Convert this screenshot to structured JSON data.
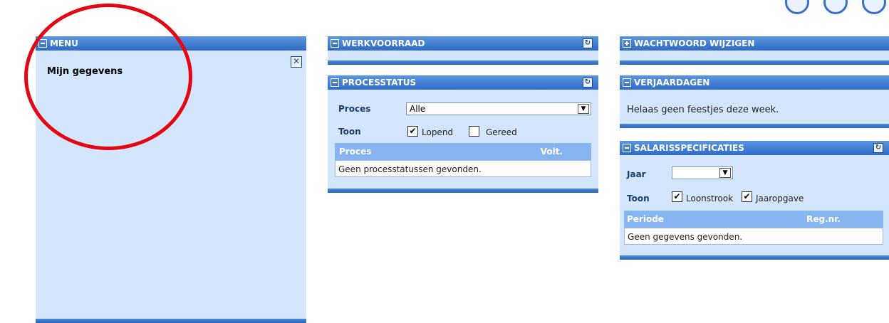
{
  "menu": {
    "title": "MENU",
    "item": "Mijn gegevens",
    "close_icon": "close-icon"
  },
  "werkvoorraad": {
    "title": "WERKVOORRAAD"
  },
  "processtatus": {
    "title": "PROCESSTATUS",
    "proces_label": "Proces",
    "proces_value": "Alle",
    "toon_label": "Toon",
    "cb1_label": "Lopend",
    "cb1_checked": true,
    "cb2_label": "Gereed",
    "cb2_checked": false,
    "col1": "Proces",
    "col2": "Volt.",
    "empty": "Geen processtatussen gevonden."
  },
  "wachtwoord": {
    "title": "WACHTWOORD WIJZIGEN"
  },
  "verjaardagen": {
    "title": "VERJAARDAGEN",
    "text": "Helaas geen feestjes deze week."
  },
  "salaris": {
    "title": "SALARISSPECIFICATIES",
    "jaar_label": "Jaar",
    "jaar_value": "",
    "toon_label": "Toon",
    "cb1_label": "Loonstrook",
    "cb1_checked": true,
    "cb2_label": "Jaaropgave",
    "cb2_checked": true,
    "col1": "Periode",
    "col2": "Reg.nr.",
    "empty": "Geen gegevens gevonden."
  },
  "colors": {
    "header_blue": "#2f6bc6",
    "panel_bg": "#d3e6fb",
    "annotation_red": "#e30613"
  }
}
